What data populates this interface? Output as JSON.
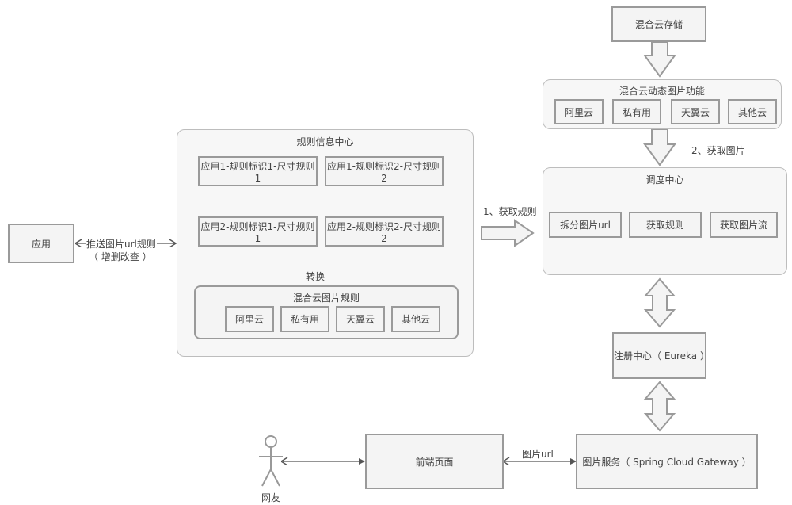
{
  "nodes": {
    "hybrid_storage": "混合云存储",
    "dynamic_image_function": {
      "title": "混合云动态图片功能",
      "items": [
        "阿里云",
        "私有用",
        "天翼云",
        "其他云"
      ]
    },
    "get_image_label": "2、获取图片",
    "dispatch_center": {
      "title": "调度中心",
      "items": [
        "拆分图片url",
        "获取规则",
        "获取图片流"
      ]
    },
    "get_rules_label": "1、获取规则",
    "rule_info_center": {
      "title": "规则信息中心",
      "rules": [
        "应用1-规则标识1-尺寸规则1",
        "应用1-规则标识2-尺寸规则2",
        "应用2-规则标识1-尺寸规则1",
        "应用2-规则标识2-尺寸规则2"
      ],
      "convert_label": "转换",
      "hybrid_rules": {
        "title": "混合云图片规则",
        "items": [
          "阿里云",
          "私有用",
          "天翼云",
          "其他云"
        ]
      }
    },
    "application": "应用",
    "push_label_line1": "推送图片url规则",
    "push_label_line2": "（ 增删改查 ）",
    "registry": "注册中心（ Eureka ）",
    "image_service": "图片服务（ Spring Cloud Gateway ）",
    "frontend_page": "前端页面",
    "image_url_label": "图片url",
    "netizen": "网友"
  }
}
